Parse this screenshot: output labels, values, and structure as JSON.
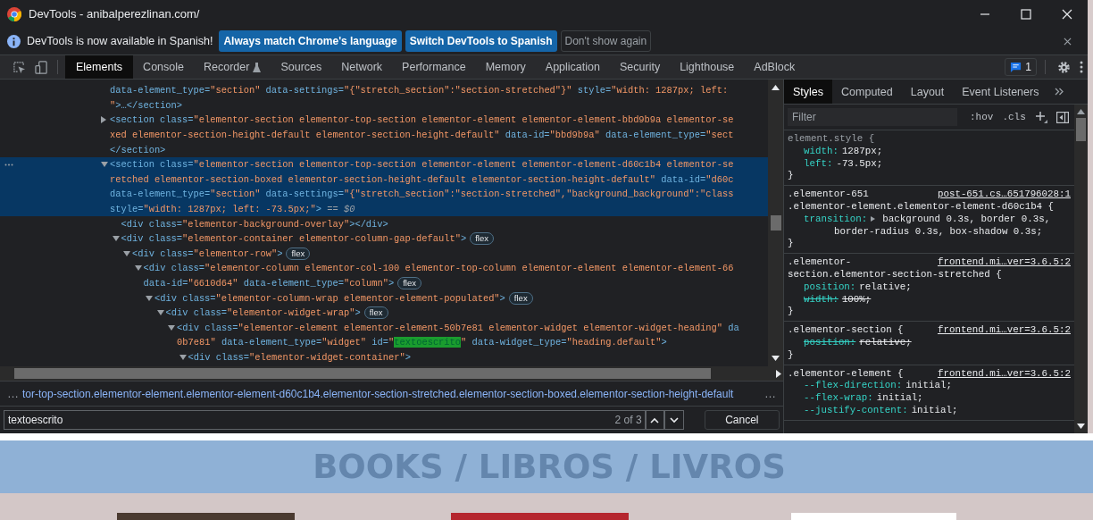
{
  "window": {
    "title": "DevTools - anibalperezlinan.com/"
  },
  "infobar": {
    "message": "DevTools is now available in Spanish!",
    "buttons": [
      {
        "label": "Always match Chrome's language",
        "kind": "primary"
      },
      {
        "label": "Switch DevTools to Spanish",
        "kind": "primary"
      },
      {
        "label": "Don't show again",
        "kind": "secondary"
      }
    ]
  },
  "tabs": [
    {
      "label": "Elements",
      "selected": true,
      "experimental": false
    },
    {
      "label": "Console",
      "selected": false,
      "experimental": false
    },
    {
      "label": "Recorder",
      "selected": false,
      "experimental": true
    },
    {
      "label": "Sources",
      "selected": false,
      "experimental": false
    },
    {
      "label": "Network",
      "selected": false,
      "experimental": false
    },
    {
      "label": "Performance",
      "selected": false,
      "experimental": false
    },
    {
      "label": "Memory",
      "selected": false,
      "experimental": false
    },
    {
      "label": "Application",
      "selected": false,
      "experimental": false
    },
    {
      "label": "Security",
      "selected": false,
      "experimental": false
    },
    {
      "label": "Lighthouse",
      "selected": false,
      "experimental": false
    },
    {
      "label": "AdBlock",
      "selected": false,
      "experimental": false
    }
  ],
  "issues_count": "1",
  "dom": [
    {
      "selected": false,
      "lines": [
        [
          {
            "tag": "data-element_type="
          },
          {
            "value": "\"section\""
          },
          {
            "tag": " data-settings="
          },
          {
            "value": "\"{\"stretch_section\":\"section-stretched\"}\""
          },
          {
            "tag": " style="
          },
          {
            "value": "\"width: 1287px; left:"
          }
        ],
        [
          {
            "value": "\""
          },
          {
            "tag": ">…</section>"
          }
        ]
      ]
    },
    {
      "selected": false,
      "expanded": false,
      "lines": [
        [
          {
            "tag": "<section class="
          },
          {
            "value": "\"elementor-section elementor-top-section elementor-element elementor-element-bbd9b9a elementor-se"
          }
        ],
        [
          {
            "value": "xed elementor-section-height-default elementor-section-height-default\""
          },
          {
            "tag": " data-id="
          },
          {
            "value": "\"bbd9b9a\""
          },
          {
            "tag": " data-element_type="
          },
          {
            "value": "\"sect"
          }
        ],
        [
          {
            "tag": "</section>"
          }
        ]
      ]
    },
    {
      "selected": true,
      "expanded": true,
      "lines": [
        [
          {
            "tag": "<section class="
          },
          {
            "value": "\"elementor-section elementor-top-section elementor-element elementor-element-d60c1b4 elementor-se"
          }
        ],
        [
          {
            "value": "retched elementor-section-boxed elementor-section-height-default elementor-section-height-default\""
          },
          {
            "tag": " data-id="
          },
          {
            "value": "\"d60c"
          }
        ],
        [
          {
            "tag": "data-element_type="
          },
          {
            "value": "\"section\""
          },
          {
            "tag": " data-settings="
          },
          {
            "value": "\"{\"stretch_section\":\"section-stretched\",\"background_background\":\"class"
          }
        ],
        [
          {
            "tag": "style="
          },
          {
            "value": "\"width: 1287px; left: -73.5px;\""
          },
          {
            "tag": ">"
          },
          {
            "marker": " == $0"
          }
        ]
      ],
      "children": [
        {
          "selected": false,
          "lines": [
            [
              {
                "tag": "<div class="
              },
              {
                "value": "\"elementor-background-overlay\""
              },
              {
                "tag": "></div>"
              }
            ]
          ]
        },
        {
          "selected": false,
          "expanded": true,
          "badge": "flex",
          "lines": [
            [
              {
                "tag": "<div class="
              },
              {
                "value": "\"elementor-container elementor-column-gap-default\""
              },
              {
                "tag": ">"
              }
            ]
          ],
          "children": [
            {
              "selected": false,
              "expanded": true,
              "badge": "flex",
              "lines": [
                [
                  {
                    "tag": "<div class="
                  },
                  {
                    "value": "\"elementor-row\""
                  },
                  {
                    "tag": ">"
                  }
                ]
              ],
              "children": [
                {
                  "selected": false,
                  "expanded": true,
                  "badge": "flex",
                  "lines": [
                    [
                      {
                        "tag": "<div class="
                      },
                      {
                        "value": "\"elementor-column elementor-col-100 elementor-top-column elementor-element elementor-element-66"
                      }
                    ],
                    [
                      {
                        "tag": "data-id="
                      },
                      {
                        "value": "\"6610d64\""
                      },
                      {
                        "tag": " data-element_type="
                      },
                      {
                        "value": "\"column\""
                      },
                      {
                        "tag": ">"
                      }
                    ]
                  ],
                  "children": [
                    {
                      "selected": false,
                      "expanded": true,
                      "badge": "flex",
                      "lines": [
                        [
                          {
                            "tag": "<div class="
                          },
                          {
                            "value": "\"elementor-column-wrap elementor-element-populated\""
                          },
                          {
                            "tag": ">"
                          }
                        ]
                      ],
                      "children": [
                        {
                          "selected": false,
                          "expanded": true,
                          "badge": "flex",
                          "lines": [
                            [
                              {
                                "tag": "<div class="
                              },
                              {
                                "value": "\"elementor-widget-wrap\""
                              },
                              {
                                "tag": ">"
                              }
                            ]
                          ],
                          "children": [
                            {
                              "selected": false,
                              "expanded": true,
                              "lines": [
                                [
                                  {
                                    "tag": "<div class="
                                  },
                                  {
                                    "value": "\"elementor-element elementor-element-50b7e81 elementor-widget elementor-widget-heading\""
                                  },
                                  {
                                    "tag": " da"
                                  }
                                ],
                                [
                                  {
                                    "value": "0b7e81\""
                                  },
                                  {
                                    "tag": " data-element_type="
                                  },
                                  {
                                    "value": "\"widget\""
                                  },
                                  {
                                    "tag": " id="
                                  },
                                  {
                                    "value": "\""
                                  },
                                  {
                                    "match": "textoescrito"
                                  },
                                  {
                                    "value": "\""
                                  },
                                  {
                                    "tag": " data-widget_type="
                                  },
                                  {
                                    "value": "\"heading.default\""
                                  },
                                  {
                                    "tag": ">"
                                  }
                                ]
                              ],
                              "children": [
                                {
                                  "selected": false,
                                  "expanded": true,
                                  "lines": [
                                    [
                                      {
                                        "tag": "<div class="
                                      },
                                      {
                                        "value": "\"elementor-widget-container\""
                                      },
                                      {
                                        "tag": ">"
                                      }
                                    ]
                                  ]
                                }
                              ]
                            }
                          ]
                        }
                      ]
                    }
                  ]
                }
              ]
            }
          ]
        }
      ]
    }
  ],
  "breadcrumb": {
    "scroll_left": "…",
    "path": "tor-top-section.elementor-element.elementor-element-d60c1b4.elementor-section-stretched.elementor-section-boxed.elementor-section-height-default",
    "scroll_right": "…"
  },
  "search": {
    "value": "textoescrito",
    "count": "2 of 3",
    "cancel": "Cancel"
  },
  "styles_tabs": [
    {
      "label": "Styles",
      "selected": true
    },
    {
      "label": "Computed",
      "selected": false
    },
    {
      "label": "Layout",
      "selected": false
    },
    {
      "label": "Event Listeners",
      "selected": false
    }
  ],
  "filter": {
    "placeholder": "Filter",
    "hov": ":hov",
    "cls": ".cls"
  },
  "rules": [
    {
      "selector": [
        "element.style {"
      ],
      "props": [
        {
          "name": "width:",
          "value": "1287px;",
          "struck": false,
          "expandable": false
        },
        {
          "name": "left:",
          "value": "-73.5px;",
          "struck": false,
          "expandable": false
        }
      ],
      "close": "}"
    },
    {
      "selector": [
        ".elementor-651",
        ".elementor-element.elementor-element-d60c1b4 {"
      ],
      "source": "post-651.cs…651796028:1",
      "props": [
        {
          "name": "transition:",
          "value": "background 0.3s, border 0.3s,",
          "wrapped_value": "border-radius 0.3s, box-shadow 0.3s;",
          "struck": false,
          "expandable": true
        }
      ],
      "close": "}"
    },
    {
      "selector": [
        ".elementor-",
        "section.elementor-section-stretched {"
      ],
      "source": "frontend.mi…ver=3.6.5:2",
      "props": [
        {
          "name": "position:",
          "value": "relative;",
          "struck": false,
          "expandable": false
        },
        {
          "name": "width:",
          "value": "100%;",
          "struck": true,
          "expandable": false
        }
      ],
      "close": "}"
    },
    {
      "selector": [
        ".elementor-section {"
      ],
      "source": "frontend.mi…ver=3.6.5:2",
      "props": [
        {
          "name": "position:",
          "value": "relative;",
          "struck": true,
          "expandable": false
        }
      ],
      "close": "}"
    },
    {
      "selector": [
        ".elementor-element {"
      ],
      "source": "frontend.mi…ver=3.6.5:2",
      "props": [
        {
          "name": "--flex-direction:",
          "value": "initial;",
          "struck": false,
          "expandable": false
        },
        {
          "name": "--flex-wrap:",
          "value": "initial;",
          "struck": false,
          "expandable": false
        },
        {
          "name": "--justify-content:",
          "value": "initial;",
          "struck": false,
          "expandable": false
        }
      ]
    }
  ],
  "page": {
    "heading": "BOOKS / LIBROS / LIVROS",
    "covers": [
      {
        "color": "#4a3a30"
      },
      {
        "color": "#b5262e"
      },
      {
        "color": "#ffffff"
      }
    ]
  }
}
